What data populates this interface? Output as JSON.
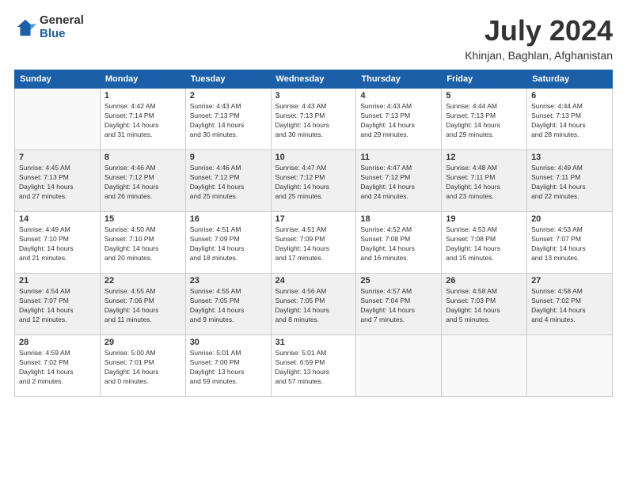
{
  "logo": {
    "general": "General",
    "blue": "Blue"
  },
  "title": "July 2024",
  "subtitle": "Khinjan, Baghlan, Afghanistan",
  "headers": [
    "Sunday",
    "Monday",
    "Tuesday",
    "Wednesday",
    "Thursday",
    "Friday",
    "Saturday"
  ],
  "weeks": [
    {
      "shaded": false,
      "days": [
        {
          "num": "",
          "info": ""
        },
        {
          "num": "1",
          "info": "Sunrise: 4:42 AM\nSunset: 7:14 PM\nDaylight: 14 hours\nand 31 minutes."
        },
        {
          "num": "2",
          "info": "Sunrise: 4:43 AM\nSunset: 7:13 PM\nDaylight: 14 hours\nand 30 minutes."
        },
        {
          "num": "3",
          "info": "Sunrise: 4:43 AM\nSunset: 7:13 PM\nDaylight: 14 hours\nand 30 minutes."
        },
        {
          "num": "4",
          "info": "Sunrise: 4:43 AM\nSunset: 7:13 PM\nDaylight: 14 hours\nand 29 minutes."
        },
        {
          "num": "5",
          "info": "Sunrise: 4:44 AM\nSunset: 7:13 PM\nDaylight: 14 hours\nand 29 minutes."
        },
        {
          "num": "6",
          "info": "Sunrise: 4:44 AM\nSunset: 7:13 PM\nDaylight: 14 hours\nand 28 minutes."
        }
      ]
    },
    {
      "shaded": true,
      "days": [
        {
          "num": "7",
          "info": "Sunrise: 4:45 AM\nSunset: 7:13 PM\nDaylight: 14 hours\nand 27 minutes."
        },
        {
          "num": "8",
          "info": "Sunrise: 4:46 AM\nSunset: 7:12 PM\nDaylight: 14 hours\nand 26 minutes."
        },
        {
          "num": "9",
          "info": "Sunrise: 4:46 AM\nSunset: 7:12 PM\nDaylight: 14 hours\nand 25 minutes."
        },
        {
          "num": "10",
          "info": "Sunrise: 4:47 AM\nSunset: 7:12 PM\nDaylight: 14 hours\nand 25 minutes."
        },
        {
          "num": "11",
          "info": "Sunrise: 4:47 AM\nSunset: 7:12 PM\nDaylight: 14 hours\nand 24 minutes."
        },
        {
          "num": "12",
          "info": "Sunrise: 4:48 AM\nSunset: 7:11 PM\nDaylight: 14 hours\nand 23 minutes."
        },
        {
          "num": "13",
          "info": "Sunrise: 4:49 AM\nSunset: 7:11 PM\nDaylight: 14 hours\nand 22 minutes."
        }
      ]
    },
    {
      "shaded": false,
      "days": [
        {
          "num": "14",
          "info": "Sunrise: 4:49 AM\nSunset: 7:10 PM\nDaylight: 14 hours\nand 21 minutes."
        },
        {
          "num": "15",
          "info": "Sunrise: 4:50 AM\nSunset: 7:10 PM\nDaylight: 14 hours\nand 20 minutes."
        },
        {
          "num": "16",
          "info": "Sunrise: 4:51 AM\nSunset: 7:09 PM\nDaylight: 14 hours\nand 18 minutes."
        },
        {
          "num": "17",
          "info": "Sunrise: 4:51 AM\nSunset: 7:09 PM\nDaylight: 14 hours\nand 17 minutes."
        },
        {
          "num": "18",
          "info": "Sunrise: 4:52 AM\nSunset: 7:08 PM\nDaylight: 14 hours\nand 16 minutes."
        },
        {
          "num": "19",
          "info": "Sunrise: 4:53 AM\nSunset: 7:08 PM\nDaylight: 14 hours\nand 15 minutes."
        },
        {
          "num": "20",
          "info": "Sunrise: 4:53 AM\nSunset: 7:07 PM\nDaylight: 14 hours\nand 13 minutes."
        }
      ]
    },
    {
      "shaded": true,
      "days": [
        {
          "num": "21",
          "info": "Sunrise: 4:54 AM\nSunset: 7:07 PM\nDaylight: 14 hours\nand 12 minutes."
        },
        {
          "num": "22",
          "info": "Sunrise: 4:55 AM\nSunset: 7:06 PM\nDaylight: 14 hours\nand 11 minutes."
        },
        {
          "num": "23",
          "info": "Sunrise: 4:55 AM\nSunset: 7:05 PM\nDaylight: 14 hours\nand 9 minutes."
        },
        {
          "num": "24",
          "info": "Sunrise: 4:56 AM\nSunset: 7:05 PM\nDaylight: 14 hours\nand 8 minutes."
        },
        {
          "num": "25",
          "info": "Sunrise: 4:57 AM\nSunset: 7:04 PM\nDaylight: 14 hours\nand 7 minutes."
        },
        {
          "num": "26",
          "info": "Sunrise: 4:58 AM\nSunset: 7:03 PM\nDaylight: 14 hours\nand 5 minutes."
        },
        {
          "num": "27",
          "info": "Sunrise: 4:58 AM\nSunset: 7:02 PM\nDaylight: 14 hours\nand 4 minutes."
        }
      ]
    },
    {
      "shaded": false,
      "days": [
        {
          "num": "28",
          "info": "Sunrise: 4:59 AM\nSunset: 7:02 PM\nDaylight: 14 hours\nand 2 minutes."
        },
        {
          "num": "29",
          "info": "Sunrise: 5:00 AM\nSunset: 7:01 PM\nDaylight: 14 hours\nand 0 minutes."
        },
        {
          "num": "30",
          "info": "Sunrise: 5:01 AM\nSunset: 7:00 PM\nDaylight: 13 hours\nand 59 minutes."
        },
        {
          "num": "31",
          "info": "Sunrise: 5:01 AM\nSunset: 6:59 PM\nDaylight: 13 hours\nand 57 minutes."
        },
        {
          "num": "",
          "info": ""
        },
        {
          "num": "",
          "info": ""
        },
        {
          "num": "",
          "info": ""
        }
      ]
    }
  ]
}
